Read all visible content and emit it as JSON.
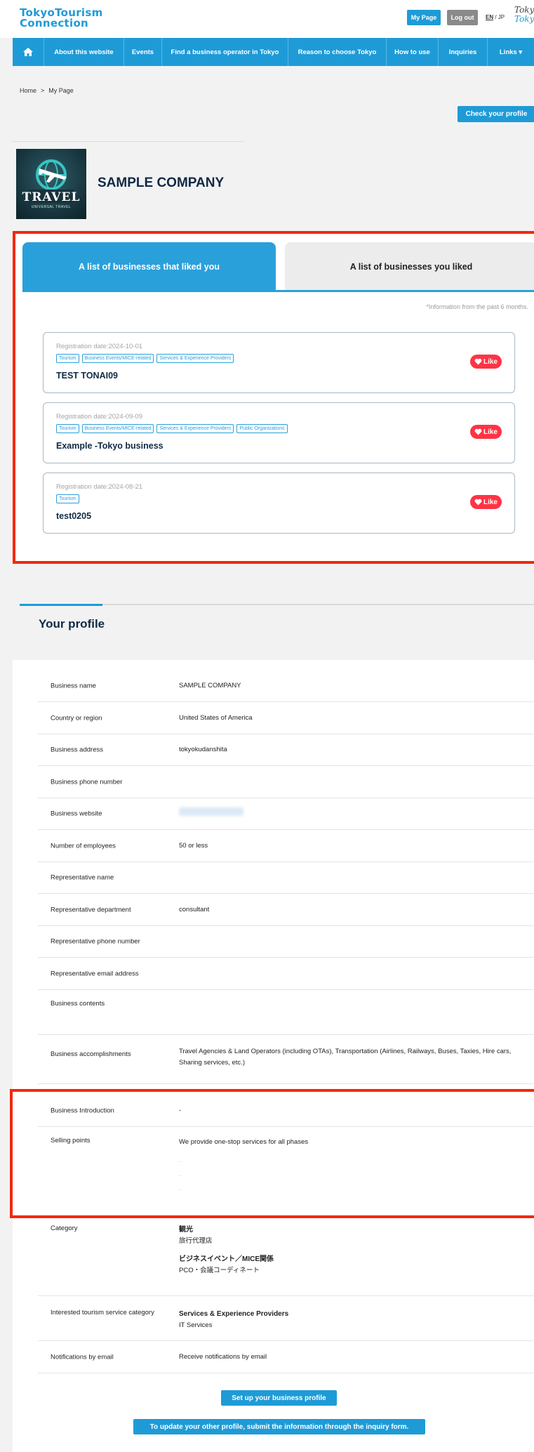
{
  "header": {
    "logo_line1": "TokyoTourism",
    "logo_line2": "Connection",
    "mypage_label": "My Page",
    "logout_label": "Log out",
    "lang_en": "EN",
    "lang_sep": " / ",
    "lang_jp": "JP",
    "brand_mark_line1": "Toky",
    "brand_mark_line2": "Toky"
  },
  "nav": {
    "items": [
      {
        "label": "About this website"
      },
      {
        "label": "Events"
      },
      {
        "label": "Find a business operator in Tokyo"
      },
      {
        "label": "Reason to choose Tokyo"
      },
      {
        "label": "How to use"
      },
      {
        "label": "Inquiries"
      },
      {
        "label": "Links ▾"
      }
    ]
  },
  "breadcrumb": {
    "home": "Home",
    "sep": ">",
    "current": "My Page"
  },
  "check_profile_label": "Check your profile",
  "company": {
    "name": "SAMPLE COMPANY",
    "image_text": "TRAVEL",
    "image_subtext": "UNIVERSAL TRAVEL"
  },
  "liked": {
    "tab_active": "A list of businesses that liked you",
    "tab_inactive": "A list of businesses you liked",
    "note": "*Information from the past 6 months.",
    "like_label": "Like",
    "cards": [
      {
        "date": "Registration date:2024-10-01",
        "tags": [
          "Tourism",
          "Business Events/MICE-related",
          "Services & Experience Providers"
        ],
        "name": "TEST TONAI09"
      },
      {
        "date": "Registration date:2024-09-09",
        "tags": [
          "Tourism",
          "Business Events/MICE-related",
          "Services & Experience Providers",
          "Public Organizations"
        ],
        "name": "Example -Tokyo business"
      },
      {
        "date": "Registration date:2024-08-21",
        "tags": [
          "Tourism"
        ],
        "name": "test0205"
      }
    ]
  },
  "profile": {
    "title": "Your profile",
    "rows": [
      {
        "label": "Business name",
        "value": "SAMPLE COMPANY"
      },
      {
        "label": "Country or region",
        "value": "United States of America"
      },
      {
        "label": "Business address",
        "value": "tokyokudanshita"
      },
      {
        "label": "Business phone number",
        "value": ""
      },
      {
        "label": "Business website",
        "value": ""
      },
      {
        "label": "Number of employees",
        "value": "50 or less"
      },
      {
        "label": "Representative name",
        "value": ""
      },
      {
        "label": "Representative department",
        "value": "consultant"
      },
      {
        "label": "Representative phone number",
        "value": ""
      },
      {
        "label": "Representative email address",
        "value": ""
      },
      {
        "label": "Business contents",
        "value": ""
      },
      {
        "label": "Business accomplishments",
        "value": "Travel Agencies & Land Operators (including OTAs), Transportation (Airlines, Railways, Buses, Taxies, Hire cars, Sharing services, etc.)"
      },
      {
        "label": "Business Introduction",
        "value": "-"
      },
      {
        "label": "Selling points",
        "value": "We provide one-stop services for all phases"
      }
    ],
    "category_label": "Category",
    "category": [
      {
        "head": "観光",
        "sub": "旅行代理店"
      },
      {
        "head": "ビジネスイベント／MICE関係",
        "sub": "PCO・会議コーディネート"
      }
    ],
    "interested_label": "Interested tourism service category",
    "interested_head": "Services & Experience Providers",
    "interested_sub": "IT Services",
    "notif_label": "Notifications by email",
    "notif_value": "Receive notifications by email"
  },
  "buttons": {
    "setup": "Set up your business profile",
    "inquiry": "To update your other profile, submit the information through the inquiry form."
  },
  "colors": {
    "brand_blue": "#1e9bd7",
    "highlight_red": "#f2290e",
    "like_red": "#ff3344"
  }
}
